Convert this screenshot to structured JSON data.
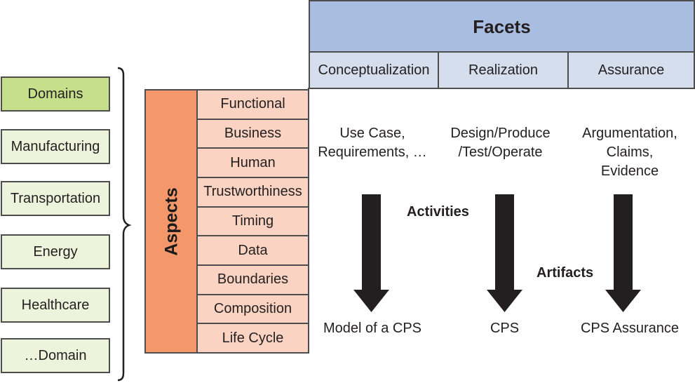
{
  "domains": {
    "header": "Domains",
    "items": [
      "Manufacturing",
      "Transportation",
      "Energy",
      "Healthcare",
      "…Domain"
    ]
  },
  "aspects": {
    "title": "Aspects",
    "items": [
      "Functional",
      "Business",
      "Human",
      "Trustworthiness",
      "Timing",
      "Data",
      "Boundaries",
      "Composition",
      "Life Cycle"
    ]
  },
  "facets": {
    "title": "Facets",
    "columns": [
      {
        "name": "Conceptualization",
        "activities": [
          "Use Case,",
          "Requirements, …"
        ],
        "artifact": "Model of a CPS"
      },
      {
        "name": "Realization",
        "activities": [
          "Design/Produce",
          "/Test/Operate"
        ],
        "artifact": "CPS"
      },
      {
        "name": "Assurance",
        "activities": [
          "Argumentation,",
          "Claims,",
          "Evidence"
        ],
        "artifact": "CPS Assurance"
      }
    ]
  },
  "labels": {
    "activities": "Activities",
    "artifacts": "Artifacts"
  },
  "colors": {
    "domain_header": "#c5df8b",
    "domain_item": "#eef3dc",
    "aspects_bar": "#f4976a",
    "aspect_item": "#fbd3c2",
    "facets_header": "#a9bde0",
    "facet_item": "#d4deec",
    "arrow": "#231f20",
    "border": "#4d4d4d"
  }
}
